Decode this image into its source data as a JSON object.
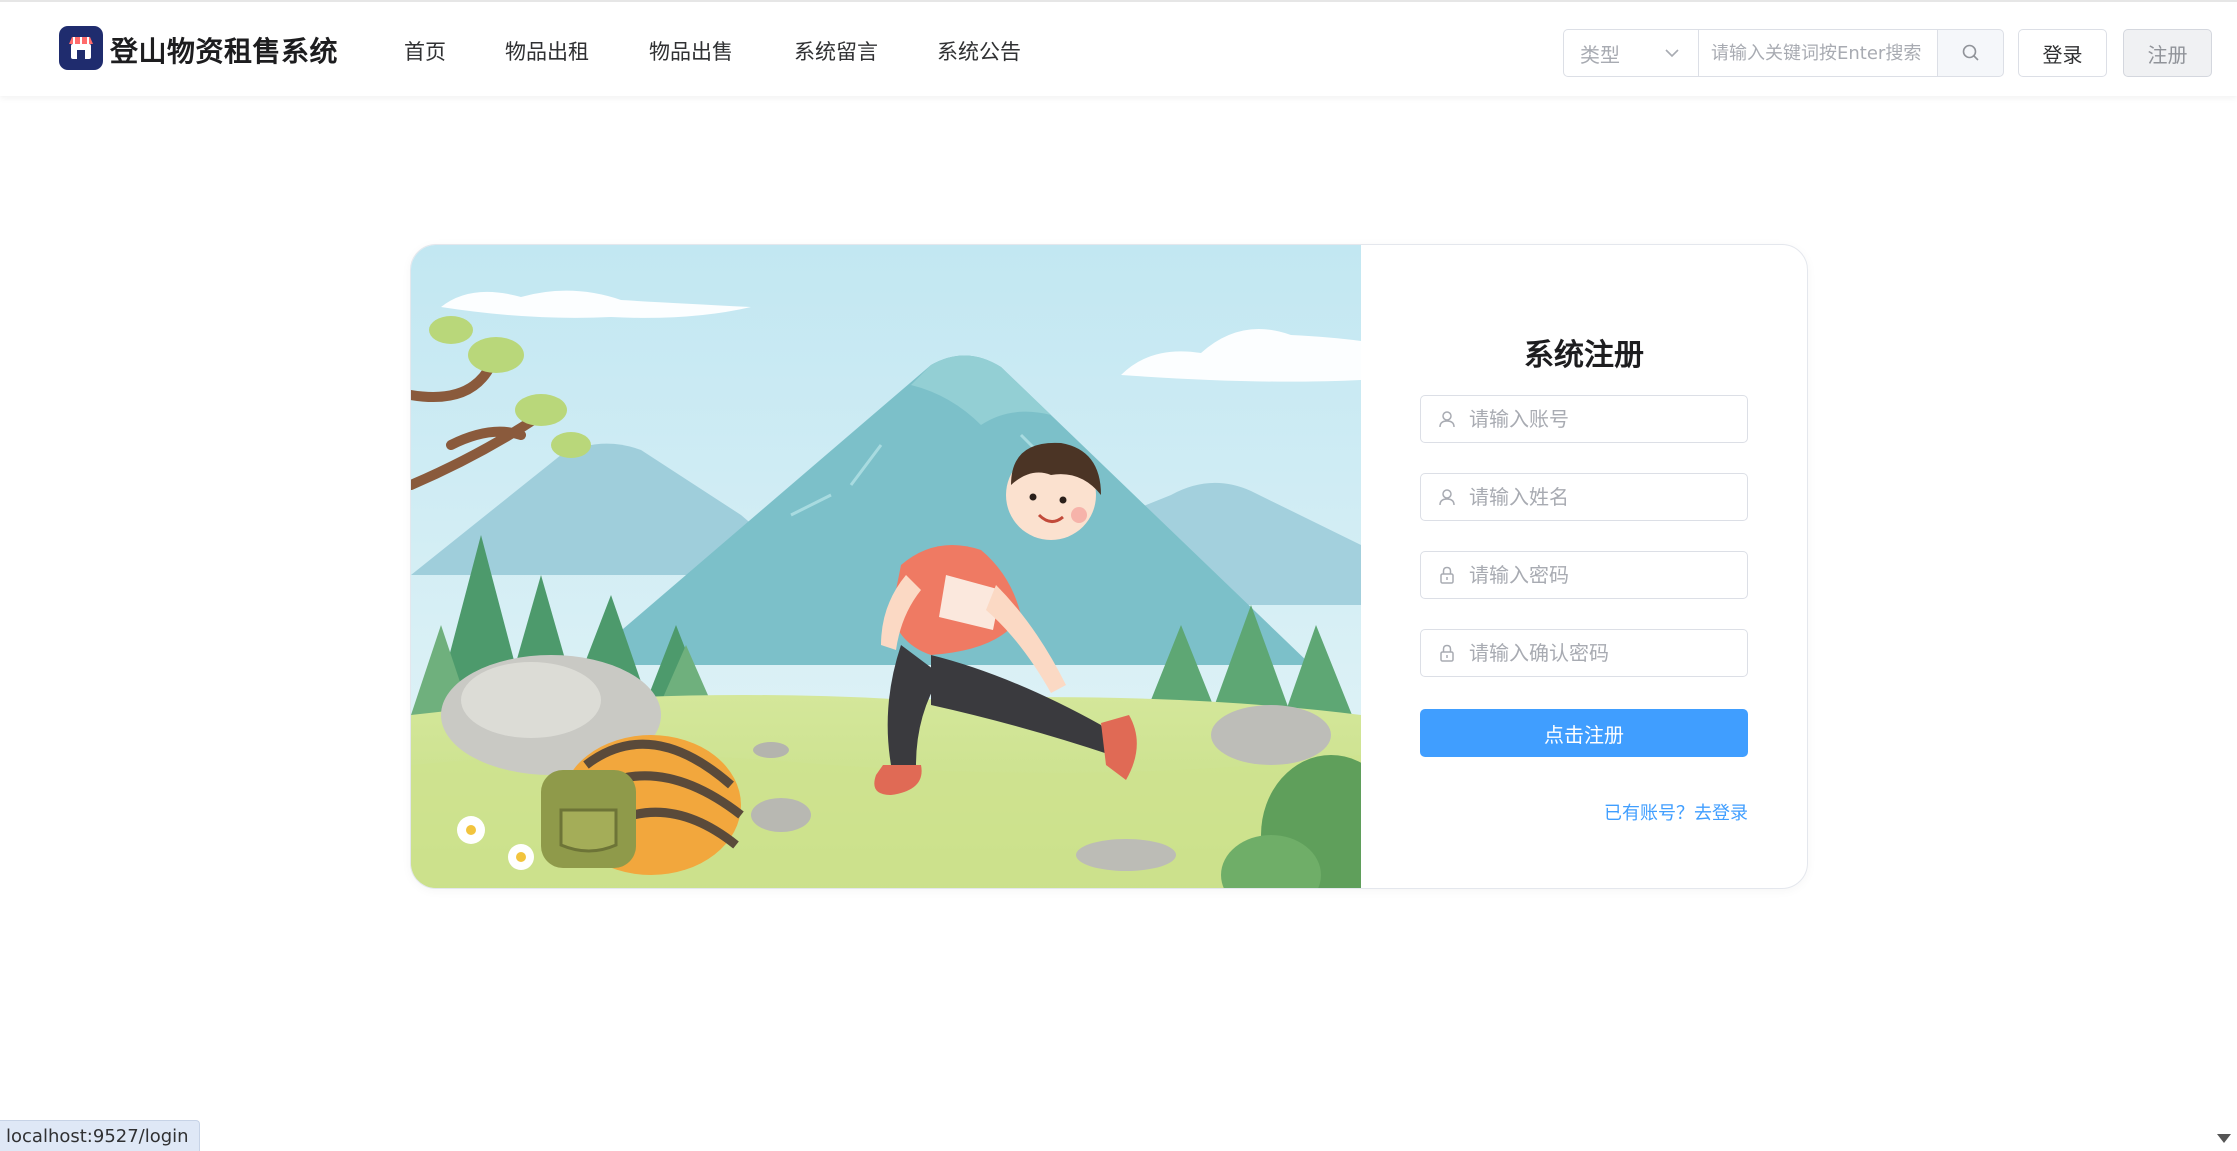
{
  "header": {
    "brand": "登山物资租售系统",
    "nav": [
      {
        "label": "首页"
      },
      {
        "label": "物品出租"
      },
      {
        "label": "物品出售"
      },
      {
        "label": "系统留言"
      },
      {
        "label": "系统公告"
      }
    ],
    "search": {
      "type_placeholder": "类型",
      "placeholder": "请输入关键词按Enter搜索"
    },
    "login_label": "登录",
    "register_label": "注册"
  },
  "form": {
    "title": "系统注册",
    "fields": [
      {
        "icon": "user-icon",
        "placeholder": "请输入账号"
      },
      {
        "icon": "user-icon",
        "placeholder": "请输入姓名"
      },
      {
        "icon": "lock-icon",
        "placeholder": "请输入密码"
      },
      {
        "icon": "lock-icon",
        "placeholder": "请输入确认密码"
      }
    ],
    "submit_label": "点击注册",
    "login_link": "已有账号？去登录"
  },
  "statusbar": {
    "url": "localhost:9527/login"
  },
  "colors": {
    "primary": "#409eff",
    "brand_bg": "#1f2c6e"
  }
}
